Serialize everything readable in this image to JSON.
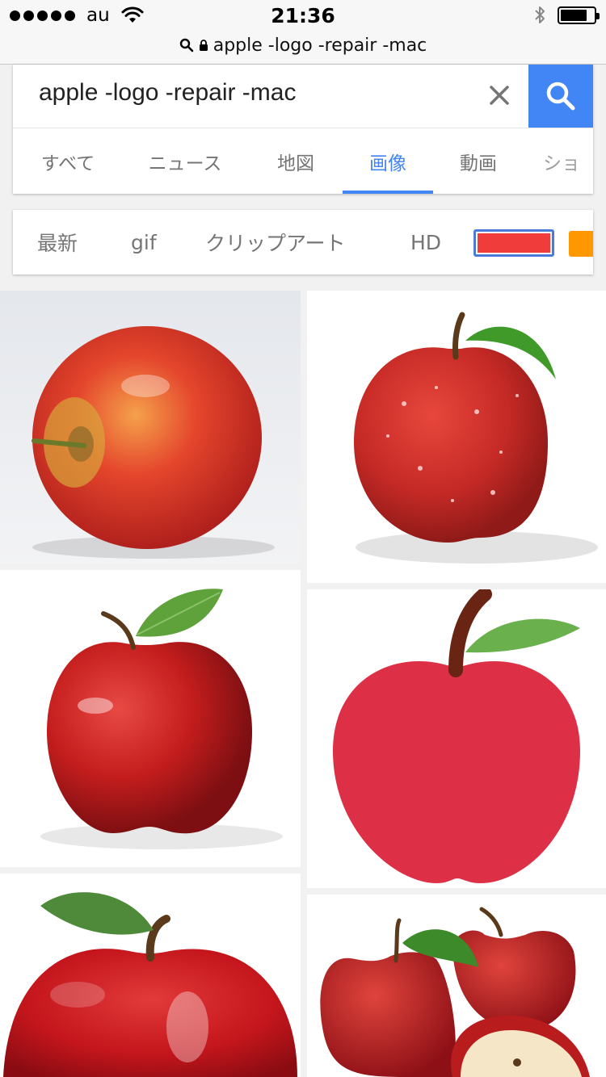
{
  "status_bar": {
    "carrier": "au",
    "time": "21:36",
    "url": "apple -logo -repair -mac"
  },
  "search": {
    "query": "apple -logo -repair -mac",
    "clear_icon": "close-icon",
    "search_icon": "search-icon",
    "accent_color": "#4285f4"
  },
  "tabs": [
    {
      "label": "すべて",
      "active": false
    },
    {
      "label": "ニュース",
      "active": false
    },
    {
      "label": "地図",
      "active": false
    },
    {
      "label": "画像",
      "active": true
    },
    {
      "label": "動画",
      "active": false
    },
    {
      "label": "ショ",
      "active": false
    }
  ],
  "filters": {
    "chips": [
      "最新",
      "gif",
      "クリップアート",
      "HD"
    ],
    "color_swatches": [
      "#f13c3c",
      "#ff9800"
    ]
  },
  "results": [
    {
      "subject": "red-yellow apple photo"
    },
    {
      "subject": "red apple with water drops and leaf"
    },
    {
      "subject": "red apple with leaf"
    },
    {
      "subject": "red apple flat illustration"
    },
    {
      "subject": "glossy red apple with leaf"
    },
    {
      "subject": "red apples with cut half"
    }
  ]
}
